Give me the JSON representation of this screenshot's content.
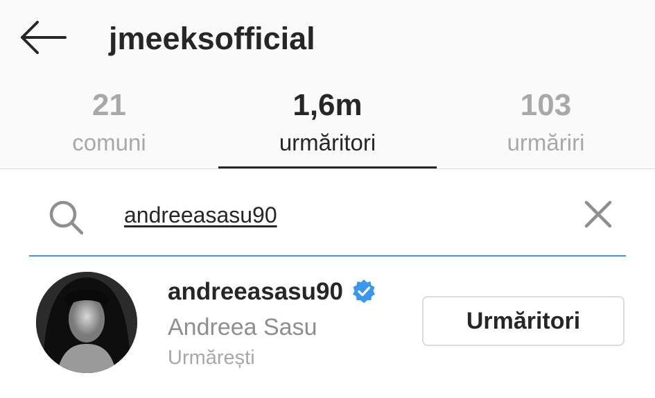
{
  "header": {
    "title": "jmeeksofficial"
  },
  "tabs": [
    {
      "count": "21",
      "label": "comuni",
      "active": false
    },
    {
      "count": "1,6m",
      "label": "urmăritori",
      "active": true
    },
    {
      "count": "103",
      "label": "urmăriri",
      "active": false
    }
  ],
  "search": {
    "value": "andreeasasu90"
  },
  "result": {
    "username": "andreeasasu90",
    "full_name": "Andreea Sasu",
    "relation": "Urmărești",
    "button_label": "Urmăritori",
    "verified": true
  },
  "colors": {
    "accent": "#3897f0",
    "verified_badge": "#3897f0",
    "header_bg": "#fafafa",
    "muted_text": "#a8a8a8"
  },
  "icons": {
    "back": "arrow-left-icon",
    "search": "search-icon",
    "clear": "close-icon",
    "verified": "verified-badge-icon"
  }
}
